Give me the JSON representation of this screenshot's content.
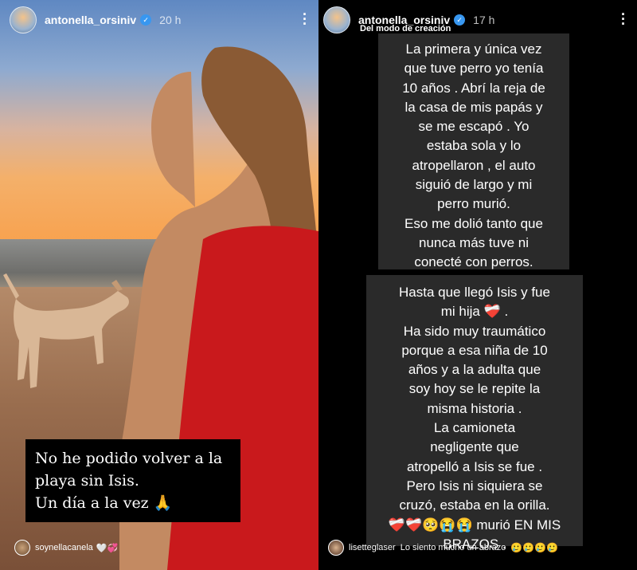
{
  "left_story": {
    "username": "antonella_orsiniv",
    "time": "20 h",
    "caption_lines": [
      "No he podido volver a la",
      "playa sin Isis.",
      "Un día a la vez 🙏"
    ],
    "reply_user": "soynellacanela",
    "reply_emojis": "🤍💞"
  },
  "right_story": {
    "username": "antonella_orsiniv",
    "time": "17 h",
    "subtitle": "Del modo de creación",
    "block1_lines": [
      "La primera y única vez",
      "que tuve perro yo tenía",
      "10 años . Abrí la reja de",
      "la casa de mis papás y",
      "se me escapó .  Yo",
      "estaba sola y lo",
      "atropellaron , el auto",
      "siguió de largo y mi",
      "perro murió.",
      "Eso me dolió tanto que",
      "nunca más tuve ni",
      "conecté con perros."
    ],
    "block2_lines": [
      "Hasta que llegó Isis y fue",
      "mi hija ❤️‍🩹 .",
      "Ha sido muy traumático",
      "porque a esa niña de 10",
      "años y a la adulta que",
      "soy hoy se le repite la",
      "misma historia .",
      "La camioneta",
      "negligente que",
      "atropelló a Isis se fue .",
      "Pero Isis ni siquiera se",
      "cruzó, estaba en la orilla.",
      "❤️‍🩹❤️‍🩹🥺😭😭 murió EN MIS",
      "BRAZOS ."
    ],
    "reply_user": "lisetteglaser",
    "reply_text": "Lo siento mucho un abrazo",
    "reply_emojis": "🥲🥲🥲🥲"
  },
  "icons": {
    "verified": "verified-badge-icon",
    "menu": "more-options-icon"
  },
  "colors": {
    "verified": "#3897f0",
    "text_block_bg": "#2a2a2a",
    "caption_bg": "#000000"
  }
}
